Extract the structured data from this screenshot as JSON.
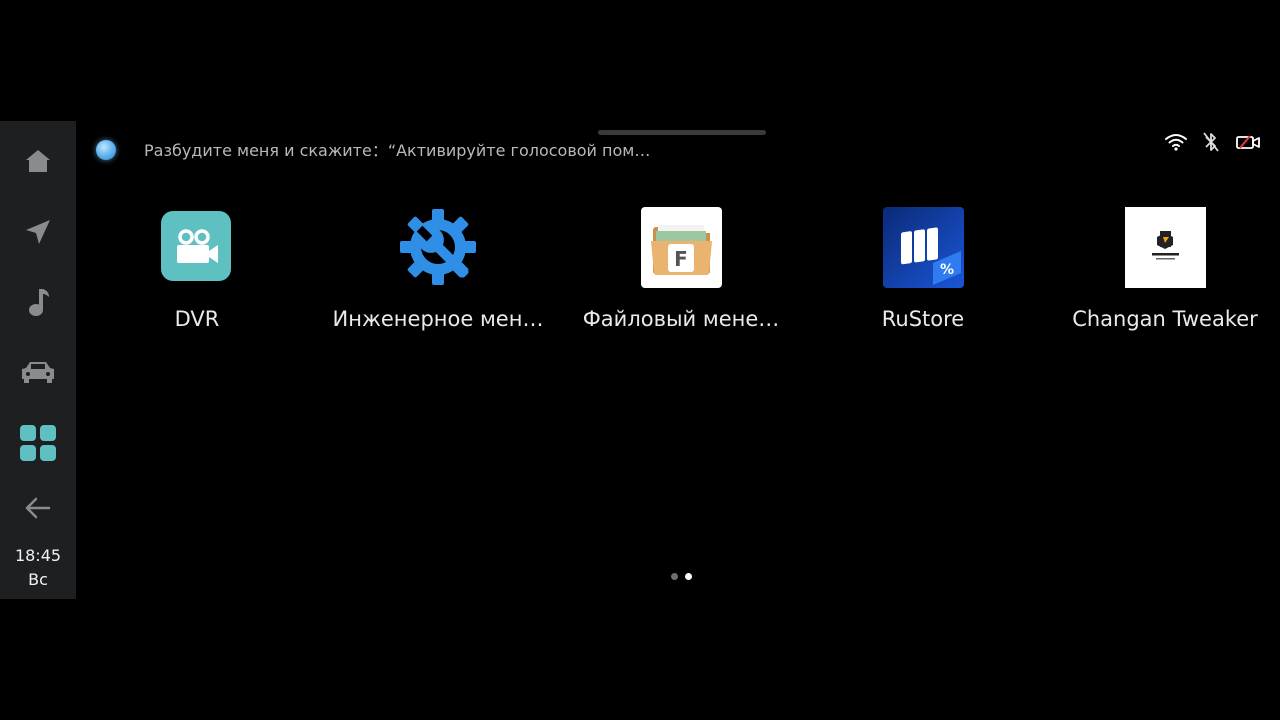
{
  "assistant": {
    "hint": "Разбудите меня и скажите：“Активируйте голосовой пом…"
  },
  "status_icons": [
    "wifi-icon",
    "bluetooth-off-icon",
    "camera-off-icon"
  ],
  "dock": {
    "items": [
      {
        "name": "home-icon"
      },
      {
        "name": "navigation-icon"
      },
      {
        "name": "music-icon"
      },
      {
        "name": "car-icon"
      },
      {
        "name": "apps-grid-icon",
        "active": true
      },
      {
        "name": "back-arrow-icon"
      }
    ],
    "time": "18:45",
    "day": "Вс"
  },
  "apps": [
    {
      "label": "DVR",
      "icon": "dvr-camera-icon",
      "color": "#5fc0c1"
    },
    {
      "label": "Инженерное мен…",
      "icon": "engineering-gear-wrench-icon",
      "color": "#2f8fe6"
    },
    {
      "label": "Файловый мене…",
      "icon": "file-manager-folder-icon",
      "color": "#e9b977"
    },
    {
      "label": "RuStore",
      "icon": "rustore-icon",
      "color": "#0f3a9e"
    },
    {
      "label": "Changan Tweaker",
      "icon": "changan-tweaker-icon",
      "color": "#ffffff"
    }
  ],
  "pager": {
    "pages": 2,
    "current": 2
  },
  "colors": {
    "background": "#000000",
    "dock": "#1e1f21",
    "accent_teal": "#5fc0c1"
  }
}
